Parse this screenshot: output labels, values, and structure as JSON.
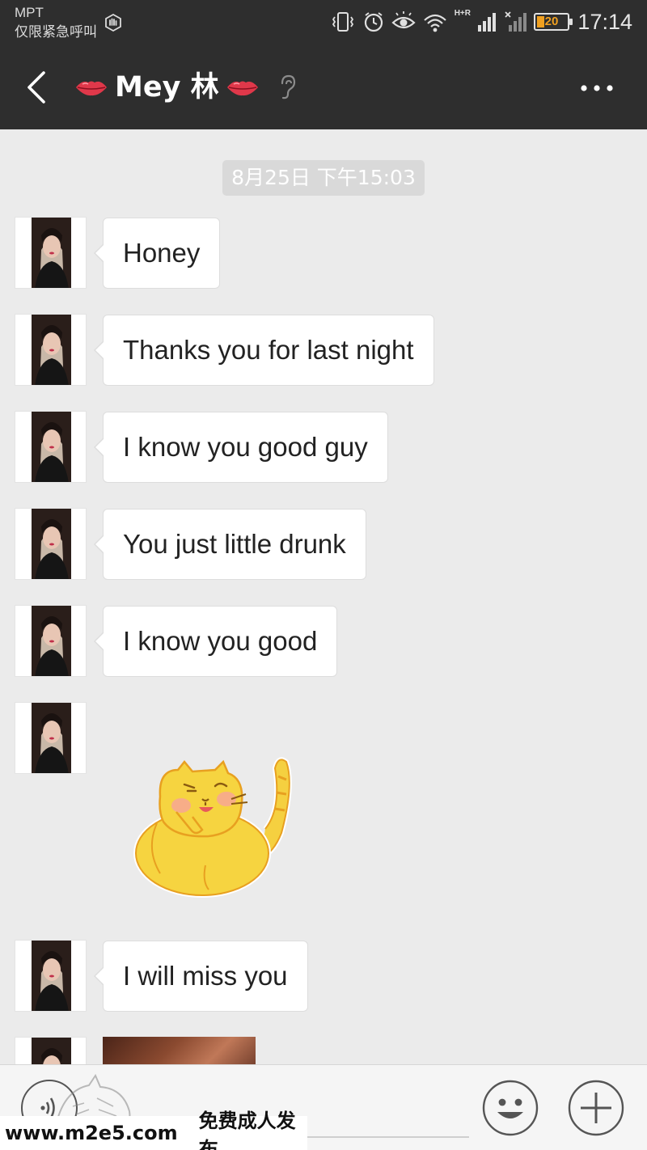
{
  "status_bar": {
    "carrier": "MPT",
    "emergency_text": "仅限紧急呼叫",
    "network": "H+R",
    "battery": "20",
    "time": "17:14"
  },
  "header": {
    "title": "Mey 林",
    "title_emoji": "lips",
    "back_icon": "chevron-left-icon",
    "mode_icon": "ear-icon",
    "more_icon": "more-dots-icon"
  },
  "chat": {
    "timestamp": "8月25日 下午15:03",
    "messages": [
      {
        "type": "text",
        "text": "Honey"
      },
      {
        "type": "text",
        "text": "Thanks you for last night"
      },
      {
        "type": "text",
        "text": "I know you good guy"
      },
      {
        "type": "text",
        "text": "You just little drunk"
      },
      {
        "type": "text",
        "text": "I know you good"
      },
      {
        "type": "sticker",
        "sticker": "shy-yellow-cat"
      },
      {
        "type": "text",
        "text": "I will miss you"
      },
      {
        "type": "image",
        "image": "photo"
      }
    ]
  },
  "input_bar": {
    "voice_icon": "voice-icon",
    "emoji_icon": "smiley-icon",
    "plus_icon": "plus-icon"
  },
  "watermark": {
    "url": "www.m2e5.com",
    "text": "免费成人发布"
  },
  "colors": {
    "header_bg": "#2e2e2e",
    "chat_bg": "#ebebeb",
    "bubble_bg": "#ffffff",
    "battery_low": "#f0a020"
  }
}
